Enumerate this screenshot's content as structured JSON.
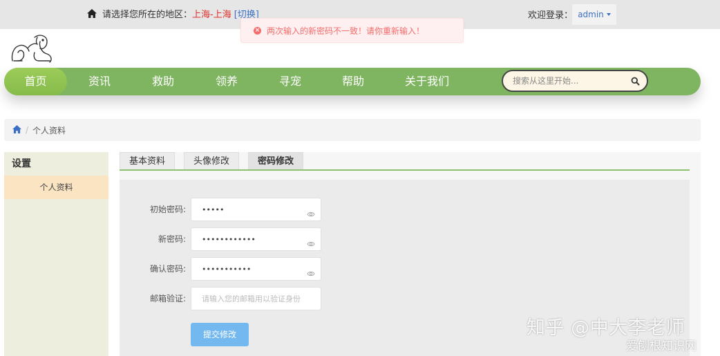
{
  "topbar": {
    "region_prompt": "请选择您所在的地区：",
    "region_city": "上海-上海",
    "region_switch": "[切换]",
    "welcome": "欢迎登录：",
    "username": "admin"
  },
  "toast": {
    "message": "两次输入的新密码不一致！请你重新输入！",
    "icon": "error-circle-icon",
    "color": "#f56c6c"
  },
  "nav": {
    "items": [
      {
        "label": "首页",
        "active": true
      },
      {
        "label": "资讯",
        "active": false
      },
      {
        "label": "救助",
        "active": false
      },
      {
        "label": "领养",
        "active": false
      },
      {
        "label": "寻宠",
        "active": false
      },
      {
        "label": "帮助",
        "active": false
      },
      {
        "label": "关于我们",
        "active": false
      }
    ],
    "search_placeholder": "搜索从这里开始...",
    "color": "#7fb461"
  },
  "breadcrumb": {
    "current": "个人资料"
  },
  "sidebar": {
    "title": "设置",
    "items": [
      {
        "label": "个人资料",
        "active": true
      }
    ]
  },
  "tabs": [
    {
      "label": "基本资料",
      "active": false
    },
    {
      "label": "头像修改",
      "active": false
    },
    {
      "label": "密码修改",
      "active": true
    }
  ],
  "form": {
    "old_password_label": "初始密码:",
    "old_password_value": "•••••",
    "new_password_label": "新密码:",
    "new_password_value": "••••••••••••",
    "confirm_password_label": "确认密码:",
    "confirm_password_value": "•••••••••••",
    "email_code_label": "邮箱验证:",
    "email_code_placeholder": "请输入您的邮箱用以验证身份",
    "submit_label": "提交修改"
  },
  "watermark": {
    "line1": "知乎 @中大李老师",
    "line2": "爱刨根知识网"
  }
}
